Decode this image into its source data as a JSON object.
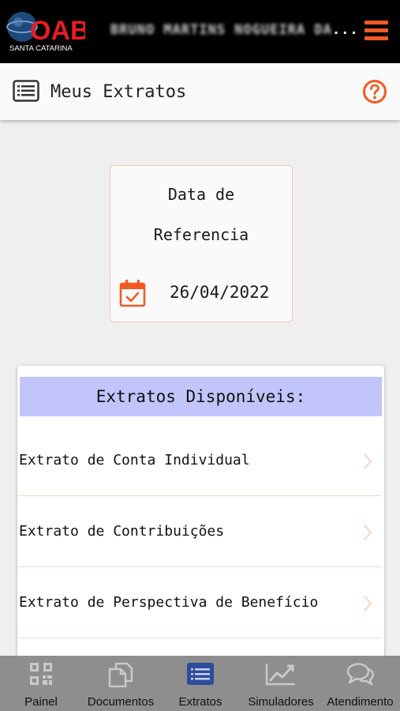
{
  "topbar": {
    "logo_text": "OAB",
    "logo_subtitle": "SANTA CATARINA",
    "user_name_obscured": "BRUNO MARTINS NOGUEIRA DA",
    "user_name_ellipsis": "..."
  },
  "header": {
    "title": "Meus Extratos"
  },
  "date_card": {
    "label_line1": "Data de",
    "label_line2": "Referencia",
    "date": "26/04/2022"
  },
  "extratos": {
    "heading": "Extratos Disponíveis:",
    "items": [
      {
        "label": "Extrato de Conta Individual"
      },
      {
        "label": "Extrato de Contribuições"
      },
      {
        "label": "Extrato de Perspectiva de Benefício"
      },
      {
        "label": ""
      }
    ]
  },
  "bottom_nav": {
    "items": [
      {
        "label": "Painel",
        "icon": "qr-code-icon"
      },
      {
        "label": "Documentos",
        "icon": "documents-icon"
      },
      {
        "label": "Extratos",
        "icon": "list-icon",
        "active": true
      },
      {
        "label": "Simuladores",
        "icon": "chart-icon"
      },
      {
        "label": "Atendimento",
        "icon": "chat-icon"
      }
    ]
  },
  "colors": {
    "accent": "#f15a24",
    "active_nav": "#2e4b9c",
    "inactive_nav_icon": "#c9c9c9",
    "list_heading_bg": "#c2c5fb",
    "logo_red": "#e31e24"
  }
}
